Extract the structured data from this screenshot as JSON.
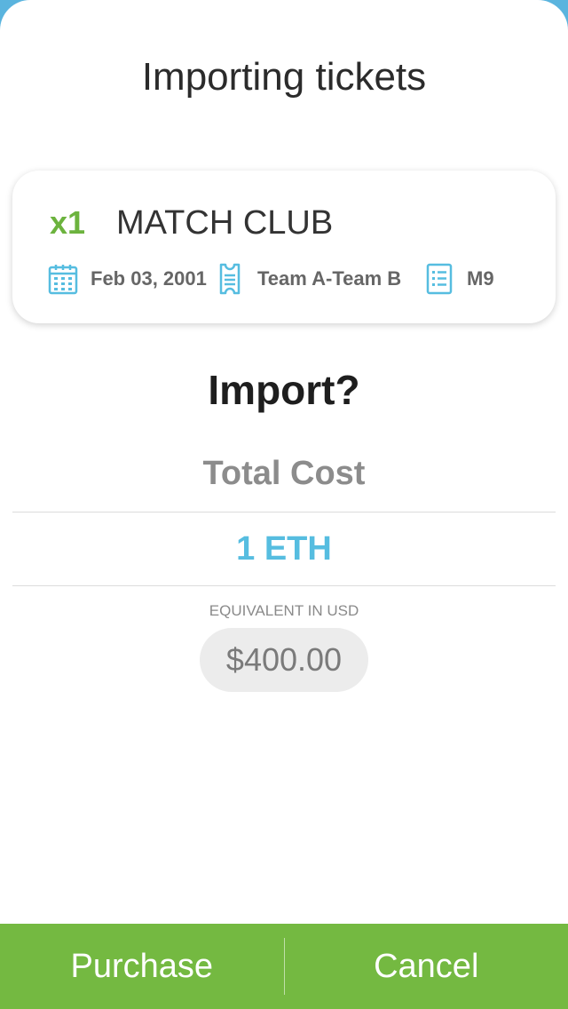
{
  "header": {
    "title": "Importing tickets"
  },
  "ticket": {
    "quantity": "x1",
    "name": "MATCH CLUB",
    "date": "Feb 03, 2001",
    "teams": "Team A-Team B",
    "match_code": "M9"
  },
  "icons": {
    "date": "calendar-icon",
    "teams": "ticket-icon",
    "match": "list-icon"
  },
  "prompt": {
    "question": "Import?"
  },
  "cost": {
    "label": "Total Cost",
    "amount": "1 ETH",
    "equivalent_label": "EQUIVALENT IN USD",
    "usd_value": "$400.00"
  },
  "actions": {
    "purchase_label": "Purchase",
    "cancel_label": "Cancel"
  },
  "colors": {
    "accent_green": "#74b941",
    "quantity_green": "#6cb33e",
    "accent_blue": "#56bde0",
    "background_blue": "#5ab4de"
  }
}
